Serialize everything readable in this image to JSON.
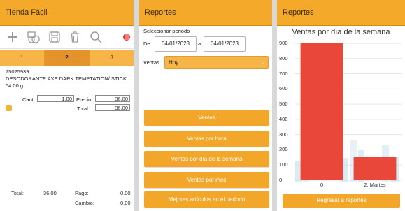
{
  "left": {
    "title": "Tienda Fácil",
    "toolbar": [
      "plus-icon",
      "coins-icon",
      "save-icon",
      "trash-icon",
      "search-icon",
      "sticker-icon"
    ],
    "tabs": [
      "1",
      "2",
      "3"
    ],
    "active_tab": 1,
    "item": {
      "sku": "75025939",
      "description": "DESODORANTE AXE DARK TEMPTATION/ STICK 54.00 g",
      "qty_label": "Cant.:",
      "qty": "1.00",
      "price_label": "Precio:",
      "price": "36.00",
      "total_label": "Total:",
      "total": "36.00"
    },
    "summary": {
      "total_label": "Total:",
      "total": "36.00",
      "paid_label": "Pago:",
      "paid": "0.00",
      "change_label": "Cambio:",
      "change": "0.00"
    }
  },
  "middle": {
    "title": "Reportes",
    "period_label": "Seleccionar periodo",
    "from_label": "De:",
    "from_date": "04/01/2023",
    "to_label": "a:",
    "to_date": "04/01/2023",
    "sales_label": "Ventas",
    "sales_option": "Hoy",
    "buttons": [
      "Ventas",
      "Ventas por hora",
      "Ventas por día de la semana",
      "Ventas por mes",
      "Mejores artículos en el periodo"
    ]
  },
  "right": {
    "title": "Reportes",
    "back_button": "Regresar a reportes"
  },
  "chart_data": {
    "type": "bar",
    "title": "Ventas por día de la semana",
    "categories": [
      "0",
      "2. Martes"
    ],
    "values": [
      900,
      155
    ],
    "ylim": [
      0,
      900
    ],
    "yticks": [
      "0",
      "100",
      "200",
      "300",
      "400",
      "500",
      "600",
      "700",
      "800",
      "900"
    ],
    "bar_color": "#e8473a",
    "grid": true
  },
  "colors": {
    "accent": "#f4a92b",
    "bar": "#e8473a"
  }
}
